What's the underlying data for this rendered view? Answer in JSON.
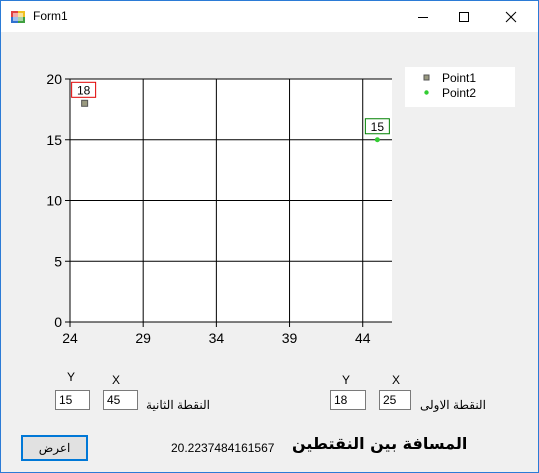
{
  "window": {
    "title": "Form1",
    "icons": {
      "app": "form-app-icon",
      "minimize": "minimize-icon",
      "maximize": "maximize-icon",
      "close": "close-icon"
    }
  },
  "chart_data": {
    "type": "scatter",
    "x_ticks": [
      "24",
      "29",
      "34",
      "39",
      "44"
    ],
    "y_ticks": [
      "0",
      "5",
      "10",
      "15",
      "20"
    ],
    "xlim": [
      24,
      46
    ],
    "ylim": [
      0,
      20
    ],
    "grid": true,
    "legend_position": "top-right",
    "series": [
      {
        "name": "Point1",
        "color": "#9a9a80",
        "marker": "square",
        "points": [
          {
            "x": 25,
            "y": 18,
            "label": "18"
          }
        ]
      },
      {
        "name": "Point2",
        "color": "#32cd32",
        "marker": "circle",
        "points": [
          {
            "x": 45,
            "y": 15,
            "label": "15"
          }
        ]
      }
    ],
    "label_box_colors": [
      "#e00000",
      "#008000"
    ]
  },
  "point2": {
    "heading": "النقطة الثانية",
    "y_label": "Y",
    "x_label": "X",
    "y_value": "15",
    "x_value": "45"
  },
  "point1": {
    "heading": "النقطة الاولى",
    "y_label": "Y",
    "x_label": "X",
    "y_value": "18",
    "x_value": "25"
  },
  "footer": {
    "show_button": "اعرض",
    "distance_label": "المسافة بين النقتطين",
    "distance_value": "20.2237484161567"
  }
}
